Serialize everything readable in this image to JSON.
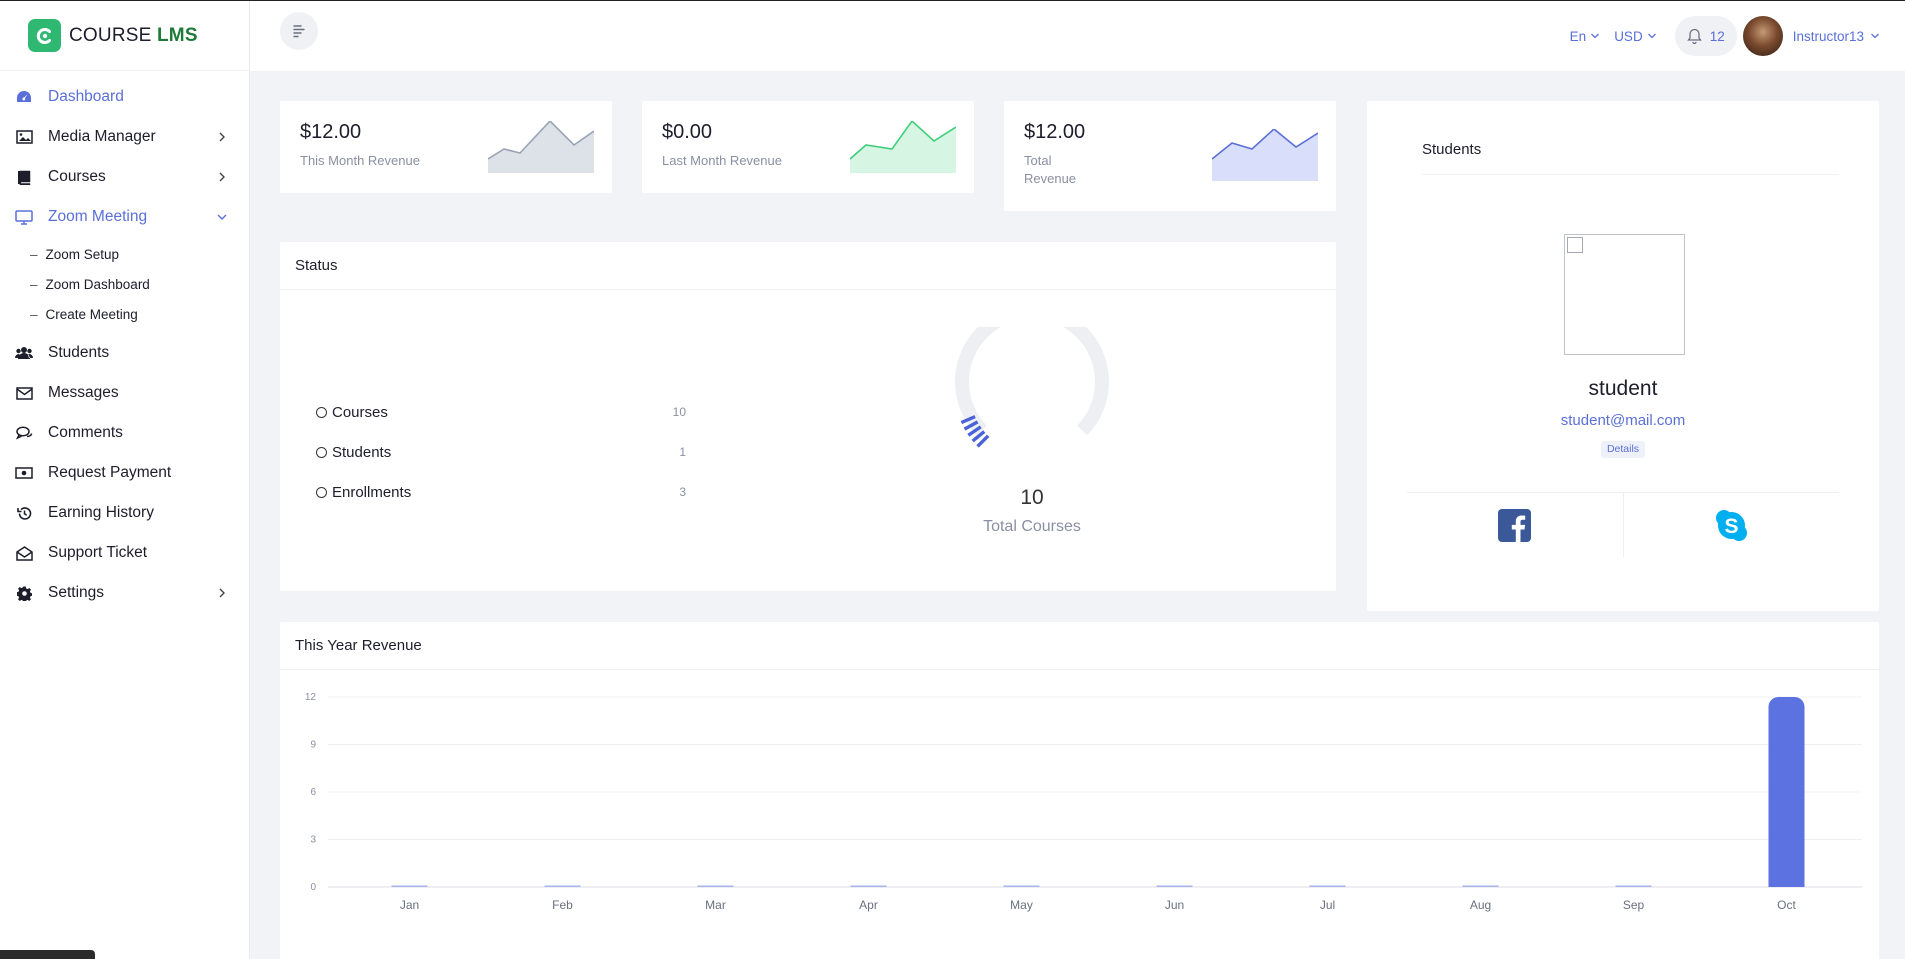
{
  "app": {
    "logo_text": "COURSE",
    "logo_accent": "LMS",
    "accent_color": "#5a6fd8",
    "brand_color": "#2eb872"
  },
  "sidebar": {
    "items": [
      {
        "label": "Dashboard",
        "icon": "dashboard-icon",
        "active": true
      },
      {
        "label": "Media Manager",
        "icon": "image-icon",
        "chevron": "right"
      },
      {
        "label": "Courses",
        "icon": "book-icon",
        "chevron": "right"
      },
      {
        "label": "Zoom Meeting",
        "icon": "monitor-icon",
        "chevron": "down",
        "active": true
      },
      {
        "label": "Students",
        "icon": "users-icon"
      },
      {
        "label": "Messages",
        "icon": "envelope-icon"
      },
      {
        "label": "Comments",
        "icon": "comments-icon"
      },
      {
        "label": "Request Payment",
        "icon": "money-icon"
      },
      {
        "label": "Earning History",
        "icon": "history-icon"
      },
      {
        "label": "Support Ticket",
        "icon": "envelope-open-icon"
      },
      {
        "label": "Settings",
        "icon": "gear-icon",
        "chevron": "right"
      }
    ],
    "zoom_sub": [
      {
        "label": "Zoom Setup"
      },
      {
        "label": "Zoom Dashboard"
      },
      {
        "label": "Create Meeting"
      }
    ],
    "sub_dash": "–"
  },
  "topbar": {
    "language": "En",
    "currency": "USD",
    "notification_count": "12",
    "username": "Instructor13"
  },
  "stats": [
    {
      "amount": "$12.00",
      "caption": "This Month Revenue",
      "color": "#9aa3b5",
      "fill": "#dde1e8"
    },
    {
      "amount": "$0.00",
      "caption": "Last Month Revenue",
      "color": "#3ecf7a",
      "fill": "#d6f5e3"
    },
    {
      "amount": "$12.00",
      "caption_line1": "Total",
      "caption_line2": "Revenue",
      "color": "#5a6fd8",
      "fill": "#d9defa"
    }
  ],
  "status": {
    "title": "Status",
    "rows": [
      {
        "name": "Courses",
        "value": "10"
      },
      {
        "name": "Students",
        "value": "1"
      },
      {
        "name": "Enrollments",
        "value": "3"
      }
    ],
    "gauge_value": "10",
    "gauge_label": "Total Courses",
    "gauge_fraction": 0.08
  },
  "students": {
    "title": "Students",
    "name": "student",
    "email": "student@mail.com",
    "details_label": "Details",
    "facebook_color": "#3b5998",
    "skype_color": "#00aff0"
  },
  "revenue": {
    "title": "This Year Revenue"
  },
  "chart_data": {
    "type": "bar",
    "categories": [
      "Jan",
      "Feb",
      "Mar",
      "Apr",
      "May",
      "Jun",
      "Jul",
      "Aug",
      "Sep",
      "Oct"
    ],
    "values": [
      0,
      0,
      0,
      0,
      0,
      0,
      0,
      0,
      0,
      12
    ],
    "yticks": [
      "12",
      "9",
      "6",
      "3",
      "0"
    ],
    "ylim": [
      0,
      12
    ],
    "grid": true,
    "bar_color": "#5b72e0"
  }
}
